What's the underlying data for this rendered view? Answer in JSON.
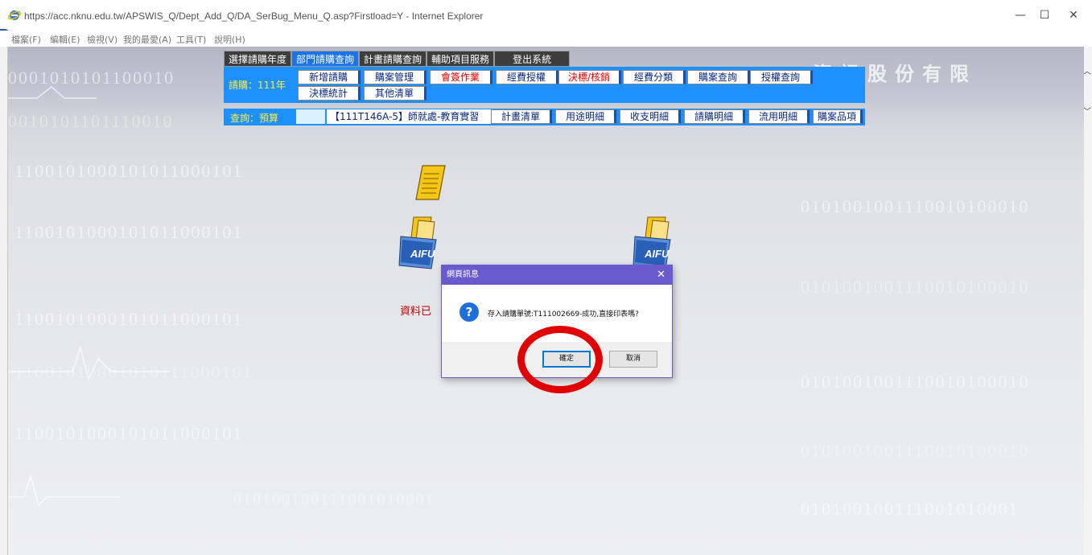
{
  "window": {
    "title": "https://acc.nknu.edu.tw/APSWIS_Q/Dept_Add_Q/DA_SerBug_Menu_Q.asp?Firstload=Y - Internet Explorer",
    "minimize": "—",
    "maximize": "☐",
    "close": "✕"
  },
  "menubar": [
    "檔案(F)",
    "編輯(E)",
    "檢視(V)",
    "我的最愛(A)",
    "工具(T)",
    "說明(H)"
  ],
  "background": {
    "binary_rows": [
      "0001010101100010",
      "0010101101110010",
      "1100101000101011000101",
      "1100101000101011000101",
      "1100101000101011000101",
      "11001010001010111000101",
      "1100101000101011000101",
      "010100100111001010001",
      "0101001001110010100010",
      "0101001001110010100010",
      "0101001001110010100010",
      "0101001001110010100010",
      "010100100111001010001"
    ],
    "company_text": "資訊股份有限"
  },
  "tabs": [
    "選擇請購年度",
    "部門請購查詢",
    "計畫請購查詢",
    "輔助項目服務",
    "登出系統"
  ],
  "nav": {
    "year_label": "請購：111年",
    "buttons_row1": [
      "新增請購",
      "購案管理",
      "會簽作業",
      "經費授權",
      "決標/核銷",
      "經費分類",
      "購案查詢",
      "授權查詢"
    ],
    "buttons_row2": [
      "決標統計",
      "其他清單"
    ]
  },
  "query": {
    "label": "查詢：預算",
    "selected_plan": "【111T146A-5】師就處-教育實習",
    "buttons": [
      "計畫清單",
      "用途明細",
      "收支明細",
      "請購明細",
      "流用明細",
      "購案品項"
    ]
  },
  "page": {
    "bg_message": "資料已",
    "icon_label": "AIFU"
  },
  "dialog": {
    "title": "網頁訊息",
    "close": "✕",
    "icon": "?",
    "message": "存入請購單號:T111002669-成功,直接印表嗎?",
    "ok": "確定",
    "cancel": "取消"
  }
}
